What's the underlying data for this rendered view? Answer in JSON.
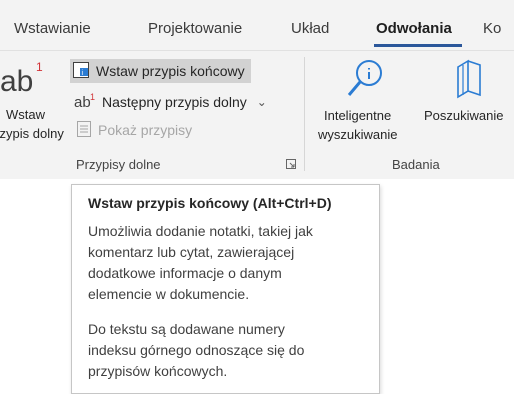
{
  "tabs": [
    {
      "label": "Wstawianie"
    },
    {
      "label": "Projektowanie"
    },
    {
      "label": "Układ"
    },
    {
      "label": "Odwołania"
    },
    {
      "label": "Ko"
    }
  ],
  "active_tab": "Odwołania",
  "footnotes_group": {
    "big_button_line1": "Wstaw",
    "big_button_line2": "przypis dolny",
    "insert_endnote": "Wstaw przypis końcowy",
    "next_footnote": "Następny przypis dolny",
    "show_notes": "Pokaż przypisy",
    "label": "Przypisy dolne"
  },
  "research_group": {
    "smart_lookup_line1": "Inteligentne",
    "smart_lookup_line2": "wyszukiwanie",
    "researcher": "Poszukiwanie",
    "label": "Badania"
  },
  "tooltip": {
    "title": "Wstaw przypis końcowy (Alt+Ctrl+D)",
    "para1": [
      "Umożliwia dodanie notatki, takiej jak",
      "komentarz lub cytat, zawierającej",
      "dodatkowe informacje o danym",
      "elemencie w dokumencie."
    ],
    "para2": [
      "Do tekstu są dodawane numery",
      "indeksu górnego odnoszące się do",
      "przypisów końcowych."
    ]
  },
  "colors": {
    "accent": "#2b579a",
    "icon_blue": "#2b7cd3"
  }
}
